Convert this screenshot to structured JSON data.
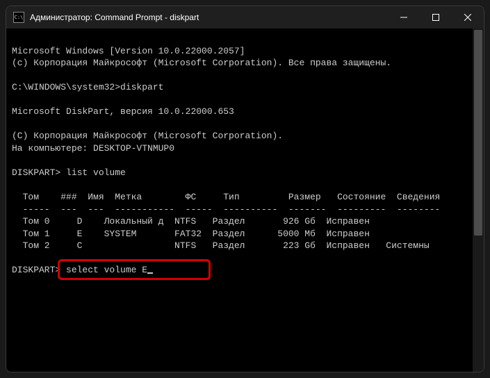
{
  "titlebar": {
    "icon_label": "C:\\",
    "title": "Администратор: Command Prompt - diskpart"
  },
  "terminal": {
    "line1": "Microsoft Windows [Version 10.0.22000.2057]",
    "line2": "(c) Корпорация Майкрософт (Microsoft Corporation). Все права защищены.",
    "blank1": "",
    "line3": "C:\\WINDOWS\\system32>diskpart",
    "blank2": "",
    "line4": "Microsoft DiskPart, версия 10.0.22000.653",
    "blank3": "",
    "line5": "(C) Корпорация Майкрософт (Microsoft Corporation).",
    "line6": "На компьютере: DESKTOP-VTNMUP0",
    "blank4": "",
    "line7": "DISKPART> list volume",
    "blank5": "",
    "header": "  Том    ###  Имя  Метка        ФС     Тип         Размер   Состояние  Сведения",
    "divider": "  -----  ---  ---  -----------  -----  ----------  -------  ---------  --------",
    "row0": "  Том 0     D    Локальный д  NTFS   Раздел       926 Gб  Исправен",
    "row1": "  Том 1     E    SYSTEM       FAT32  Раздел      5000 Mб  Исправен",
    "row2": "  Том 2     C                 NTFS   Раздел       223 Gб  Исправен   Системны",
    "blank6": "",
    "prompt2_prefix": "DISKPART> ",
    "prompt2_cmd": "select volume E"
  }
}
